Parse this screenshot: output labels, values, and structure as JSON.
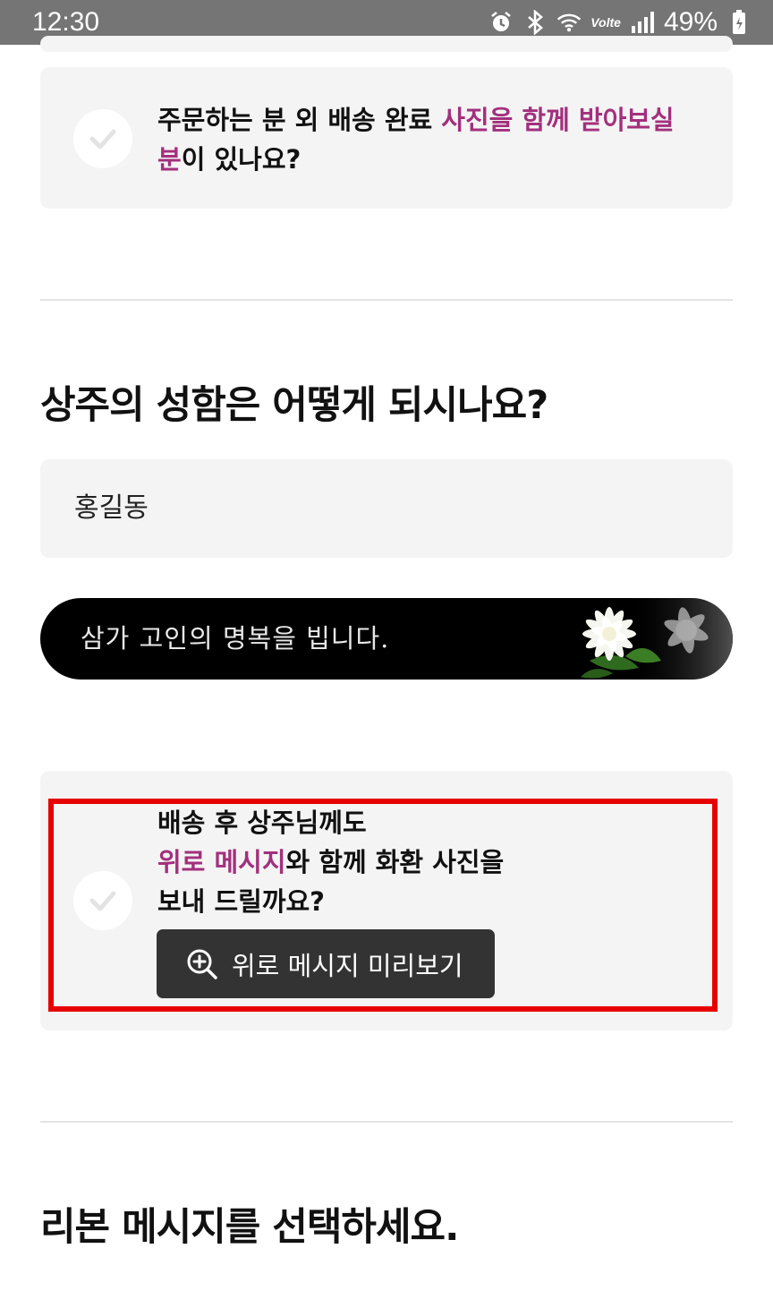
{
  "status_bar": {
    "time": "12:30",
    "network_label": "Volte",
    "battery": "49%",
    "icons": [
      "alarm-icon",
      "bluetooth-icon",
      "wifi-icon",
      "volte-icon",
      "signal-icon",
      "battery-icon"
    ]
  },
  "photo_option": {
    "text_plain_1": "주문하는 분 외 배송 완료 ",
    "text_highlight": "사진을 함께 받아보실",
    "text_highlight_2": "분",
    "text_plain_2": "이 있나요?",
    "checked": false
  },
  "mourner_section": {
    "title": "상주의 성함은 어떻게 되시나요?",
    "name_value": "홍길동"
  },
  "ribbon_preview": {
    "text": "삼가 고인의 명복을 빕니다."
  },
  "consolation_option": {
    "line1": "배송 후 상주님께도",
    "line2_highlight": "위로 메시지",
    "line2_plain": "와 함께 화환 사진을",
    "line3": "보내 드릴까요?",
    "preview_button_label": "위로 메시지 미리보기",
    "checked": false
  },
  "ribbon_section": {
    "title": "리본 메시지를 선택하세요."
  },
  "colors": {
    "accent": "#a2307d",
    "card_bg": "#f4f4f4",
    "button_bg": "#333333",
    "highlight_border": "#e60000"
  }
}
